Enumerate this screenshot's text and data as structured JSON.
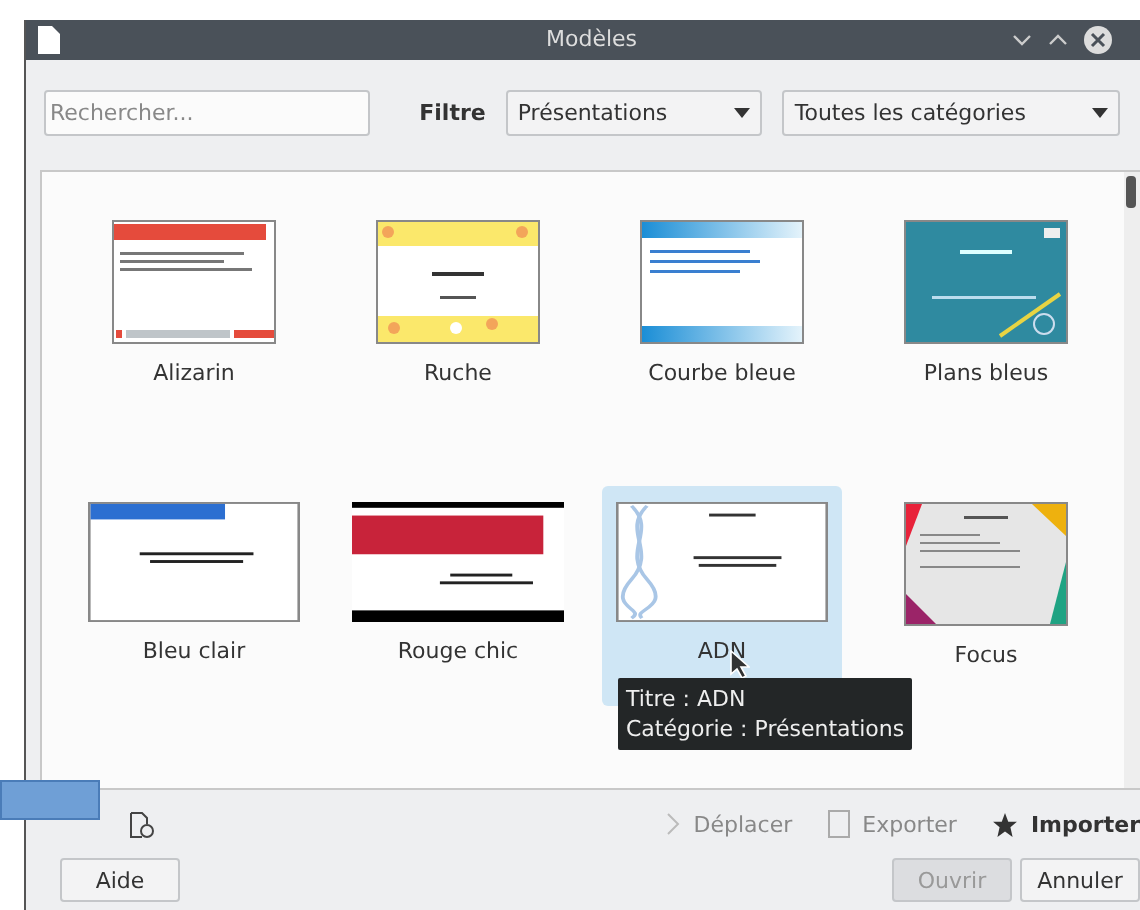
{
  "window": {
    "title": "Modèles"
  },
  "search": {
    "placeholder": "Rechercher..."
  },
  "filter": {
    "label": "Filtre",
    "application": "Présentations",
    "category": "Toutes les catégories"
  },
  "templates": [
    {
      "name": "Alizarin",
      "kind": "alizarin",
      "selected": false
    },
    {
      "name": "Ruche",
      "kind": "ruche",
      "selected": false
    },
    {
      "name": "Courbe bleue",
      "kind": "courbe",
      "selected": false
    },
    {
      "name": "Plans bleus",
      "kind": "plans",
      "selected": false
    },
    {
      "name": "Bleu clair",
      "kind": "bleuclair",
      "selected": false
    },
    {
      "name": "Rouge chic",
      "kind": "rouge",
      "selected": false
    },
    {
      "name": "ADN",
      "kind": "adn",
      "selected": true
    },
    {
      "name": "Focus",
      "kind": "focus",
      "selected": false
    }
  ],
  "tooltip": {
    "lines": [
      "Titre : ADN",
      "Catégorie : Présentations"
    ]
  },
  "actions": [
    {
      "label": "Déplacer",
      "kind": "move",
      "disabled": true
    },
    {
      "label": "Exporter",
      "kind": "export",
      "disabled": true
    },
    {
      "label": "Importer",
      "kind": "import",
      "disabled": false
    }
  ],
  "buttons": [
    {
      "label": "Aide",
      "disabled": false
    },
    {
      "label": "Ouvrir",
      "disabled": true
    },
    {
      "label": "Annuler",
      "disabled": false
    }
  ]
}
